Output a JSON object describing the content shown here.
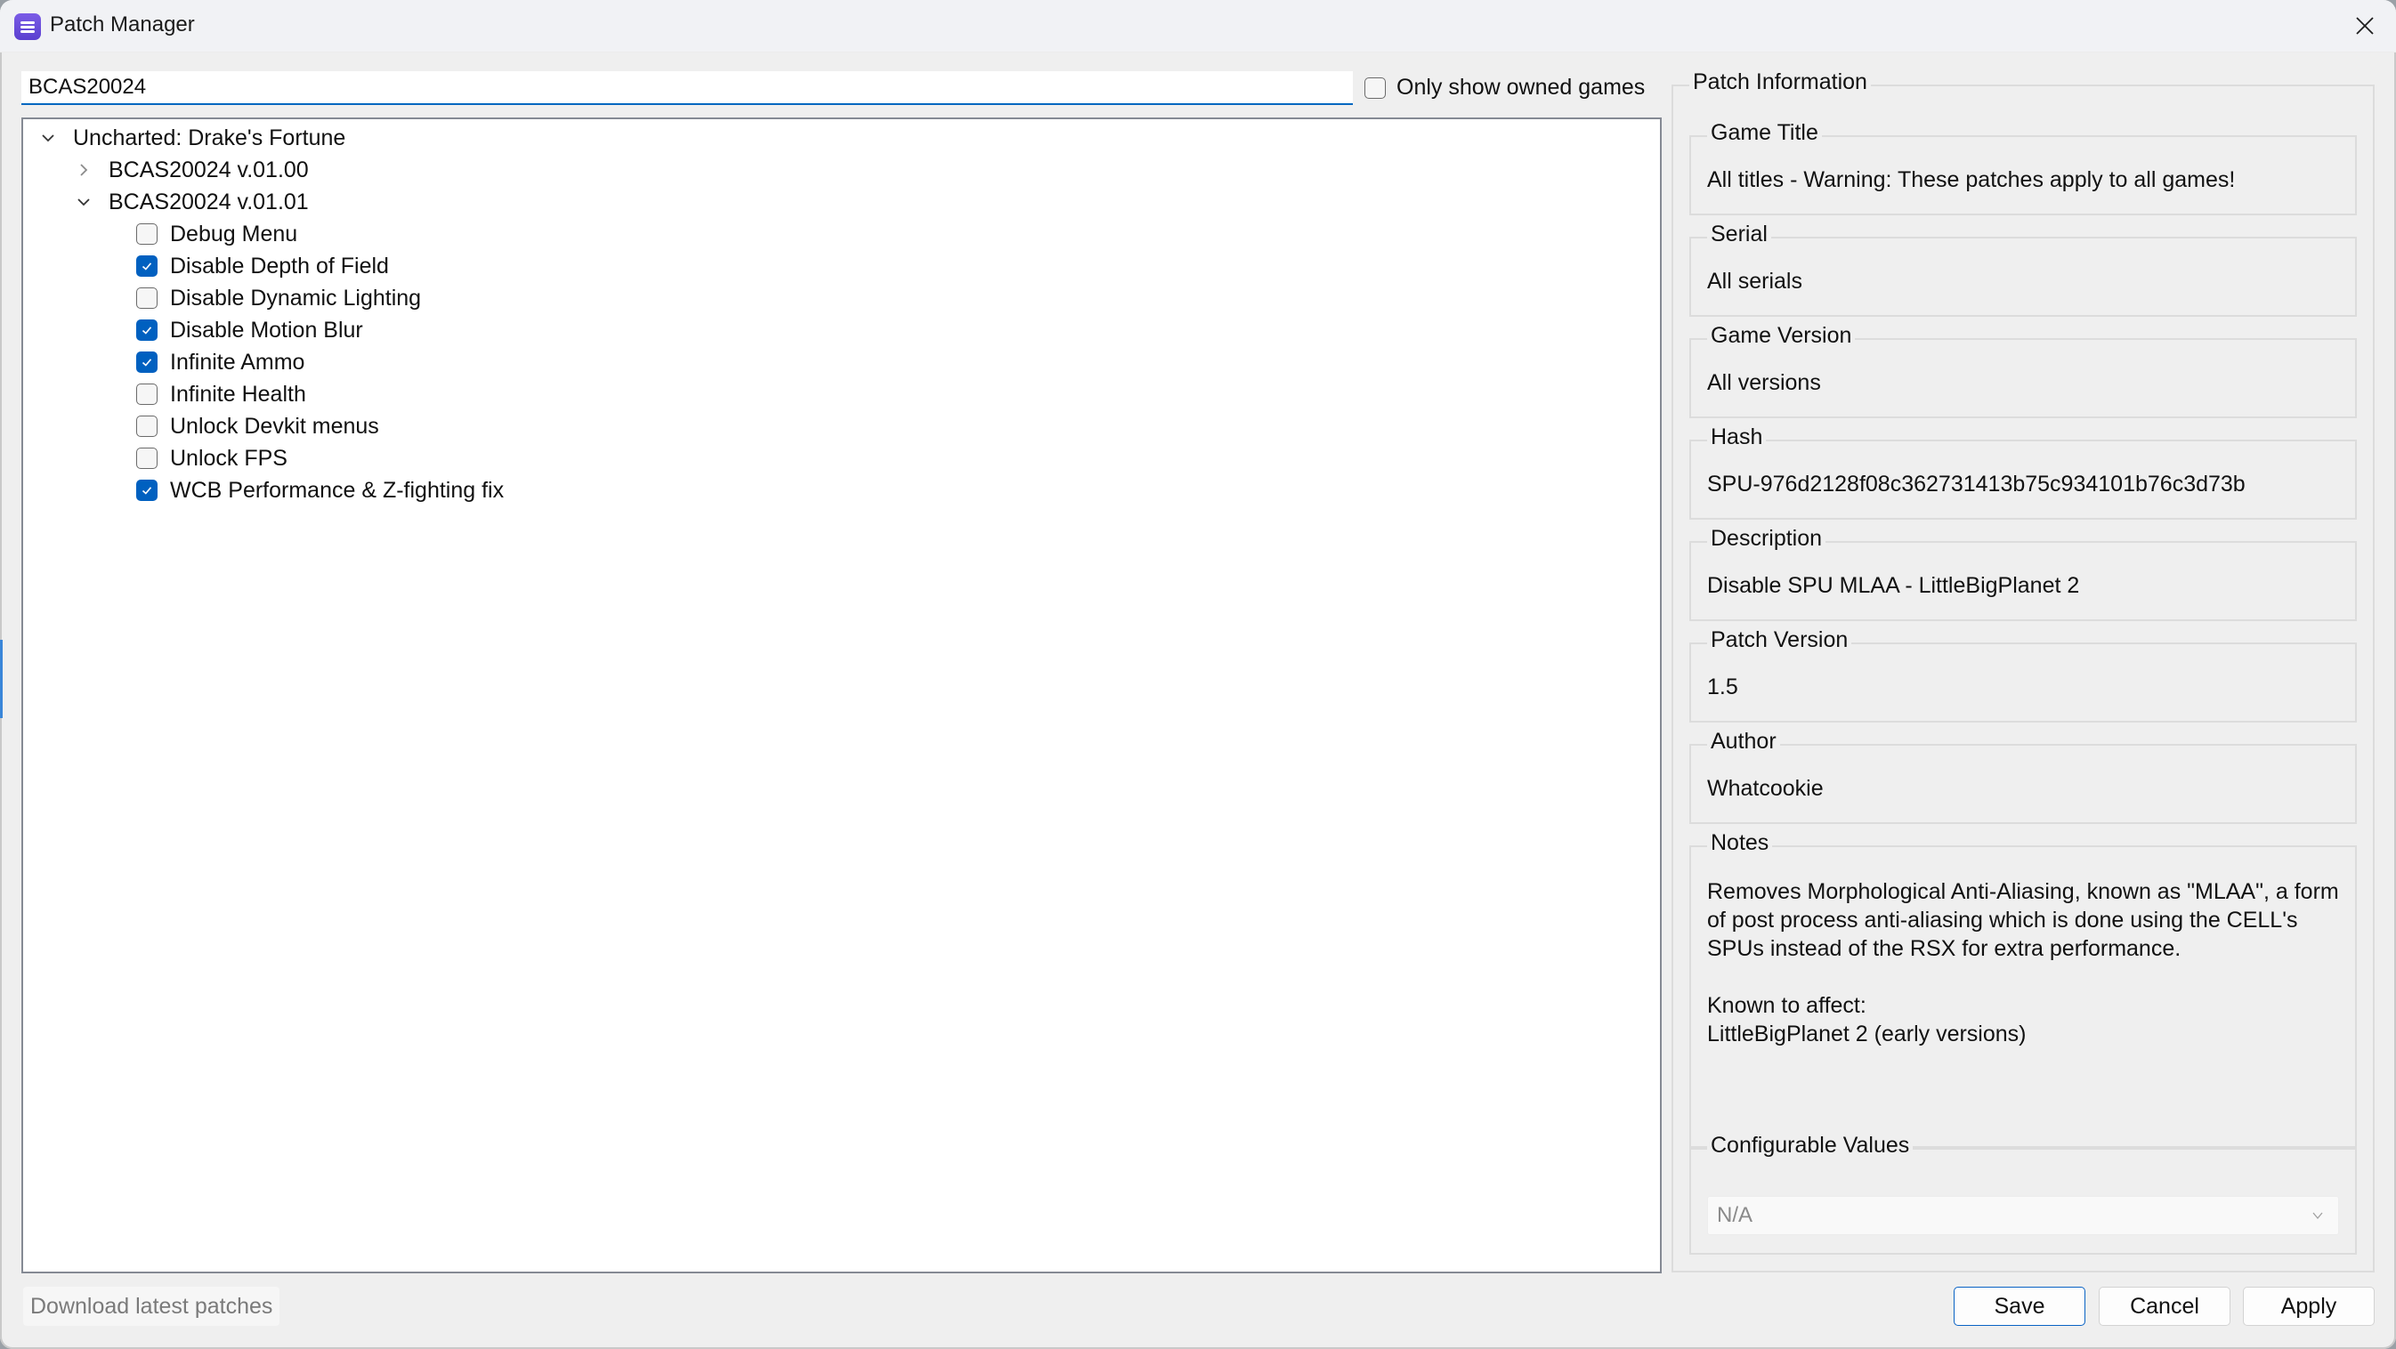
{
  "window": {
    "title": "Patch Manager",
    "icon": "app-icon",
    "close_icon": "close-icon"
  },
  "filter": {
    "search_value": "BCAS20024",
    "owned_label": "Only show owned games",
    "owned_checked": false
  },
  "tree": {
    "game": {
      "label": "Uncharted: Drake's Fortune",
      "expanded": true,
      "versions": [
        {
          "label": "BCAS20024 v.01.00",
          "expanded": false,
          "patches": []
        },
        {
          "label": "BCAS20024 v.01.01",
          "expanded": true,
          "patches": [
            {
              "label": "Debug Menu",
              "checked": false
            },
            {
              "label": "Disable Depth of Field",
              "checked": true
            },
            {
              "label": "Disable Dynamic Lighting",
              "checked": false
            },
            {
              "label": "Disable Motion Blur",
              "checked": true
            },
            {
              "label": "Infinite Ammo",
              "checked": true
            },
            {
              "label": "Infinite Health",
              "checked": false
            },
            {
              "label": "Unlock Devkit menus",
              "checked": false
            },
            {
              "label": "Unlock FPS",
              "checked": false
            },
            {
              "label": "WCB Performance & Z-fighting fix",
              "checked": true
            }
          ]
        }
      ]
    }
  },
  "info": {
    "title": "Patch Information",
    "fields": [
      {
        "label": "Game Title",
        "value": "All titles - Warning: These patches apply to all games!"
      },
      {
        "label": "Serial",
        "value": "All serials"
      },
      {
        "label": "Game Version",
        "value": "All versions"
      },
      {
        "label": "Hash",
        "value": "SPU-976d2128f08c362731413b75c934101b76c3d73b"
      },
      {
        "label": "Description",
        "value": "Disable SPU MLAA - LittleBigPlanet 2"
      },
      {
        "label": "Patch Version",
        "value": "1.5"
      },
      {
        "label": "Author",
        "value": "Whatcookie"
      }
    ],
    "notes": {
      "label": "Notes",
      "value": "Removes Morphological Anti-Aliasing, known as \"MLAA\", a form of post process anti-aliasing which is done using the CELL's SPUs instead of the RSX for extra performance.\n\nKnown to affect:\nLittleBigPlanet 2 (early versions)"
    },
    "config": {
      "label": "Configurable Values",
      "selected": "N/A"
    }
  },
  "footer": {
    "download_label": "Download latest patches",
    "save_label": "Save",
    "cancel_label": "Cancel",
    "apply_label": "Apply"
  },
  "colors": {
    "accent": "#0060c0",
    "app_icon": "#6a4ddc"
  }
}
